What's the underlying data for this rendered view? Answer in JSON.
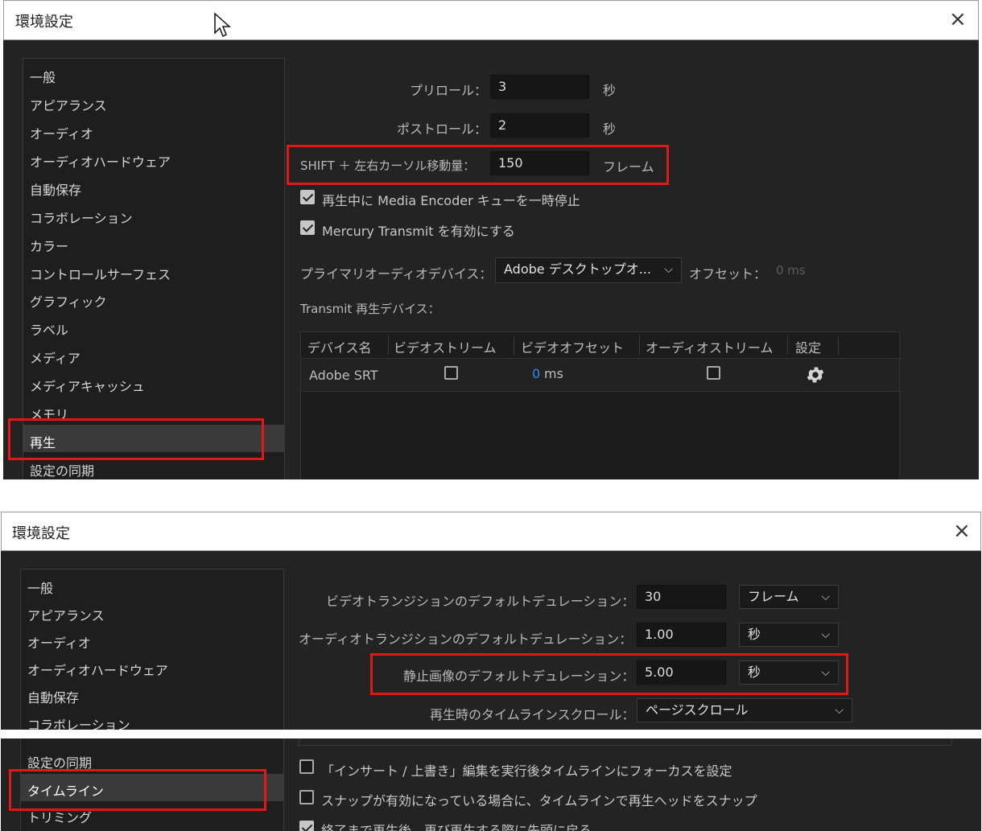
{
  "top": {
    "title": "環境設定",
    "close": "×",
    "sidebar": [
      "一般",
      "アピアランス",
      "オーディオ",
      "オーディオハードウェア",
      "自動保存",
      "コラボレーション",
      "カラー",
      "コントロールサーフェス",
      "グラフィック",
      "ラベル",
      "メディア",
      "メディアキャッシュ",
      "メモリ",
      "再生",
      "設定の同期"
    ],
    "selected_item": "再生",
    "preroll": {
      "label": "プリロール：",
      "value": "3",
      "unit": "秒"
    },
    "postroll": {
      "label": "ポストロール：",
      "value": "2",
      "unit": "秒"
    },
    "shift": {
      "label": "SHIFT ＋ 左右カーソル移動量：",
      "value": "150",
      "unit": "フレーム"
    },
    "checkbox_pause": {
      "label": "再生中に Media Encoder キューを一時停止",
      "checked": true
    },
    "checkbox_mercury": {
      "label": "Mercury Transmit を有効にする",
      "checked": true
    },
    "audio_device": {
      "label": "プライマリオーディオデバイス：",
      "value": "Adobe デスクトップオ...",
      "offset_label": "オフセット：",
      "offset_value": "0 ms"
    },
    "transmit_label": "Transmit 再生デバイス：",
    "table": {
      "headers": [
        "デバイス名",
        "ビデオストリーム",
        "ビデオオフセット",
        "オーディオストリーム",
        "設定"
      ],
      "row": {
        "device": "Adobe SRT",
        "video_offset_num": "0",
        "video_offset_unit": "ms"
      }
    }
  },
  "bottom": {
    "title": "環境設定",
    "close": "×",
    "sidebar": [
      "一般",
      "アピアランス",
      "オーディオ",
      "オーディオハードウェア",
      "自動保存",
      "コラボレーション"
    ],
    "sidebar2": [
      "設定の同期",
      "タイムライン",
      "トリミング"
    ],
    "selected_item": "タイムライン",
    "video_transition": {
      "label": "ビデオトランジションのデフォルトデュレーション：",
      "value": "30",
      "unit": "フレーム"
    },
    "audio_transition": {
      "label": "オーディオトランジションのデフォルトデュレーション：",
      "value": "1.00",
      "unit": "秒"
    },
    "still_image": {
      "label": "静止画像のデフォルトデュレーション：",
      "value": "5.00",
      "unit": "秒"
    },
    "timeline_scroll": {
      "label": "再生時のタイムラインスクロール：",
      "value": "ページスクロール"
    },
    "checkbox_insert": {
      "label": "「インサート / 上書き」編集を実行後タイムラインにフォーカスを設定",
      "checked": false
    },
    "checkbox_snap": {
      "label": "スナップが有効になっている場合に、タイムラインで再生ヘッドをスナップ",
      "checked": false
    },
    "checkbox_return": {
      "label": "終了まで再生後、再び再生する際に先頭に戻る",
      "checked": true
    }
  },
  "colors": {
    "highlight": "#e01818",
    "accent_blue": "#2d8ceb",
    "panel": "#232323"
  }
}
